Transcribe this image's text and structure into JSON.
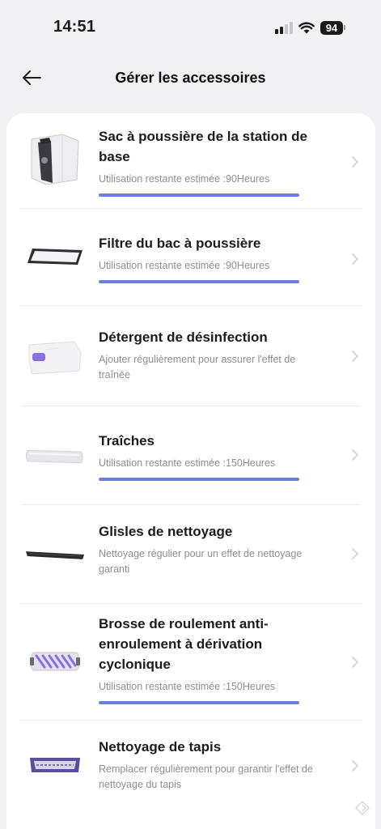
{
  "status_bar": {
    "time": "14:51",
    "battery": "94"
  },
  "header": {
    "title": "Gérer les accessoires"
  },
  "accessories": [
    {
      "title_lines": [
        "Sac à poussière de la station de",
        "base"
      ],
      "subtitle": "Utilisation restante estimée :90Heures",
      "progress": 1.0
    },
    {
      "title_lines": [
        "Filtre du bac à poussière"
      ],
      "subtitle": "Utilisation restante estimée :90Heures",
      "progress": 1.0
    },
    {
      "title_lines": [
        "Détergent de désinfection"
      ],
      "subtitle_lines": [
        "Ajouter régulièrement pour assurer l'effet de",
        "traînée"
      ]
    },
    {
      "title_lines": [
        "Traîches"
      ],
      "subtitle": "Utilisation restante estimée :150Heures",
      "progress": 1.0
    },
    {
      "title_lines": [
        "Glisles de nettoyage"
      ],
      "subtitle_lines": [
        "Nettoyage régulier pour un effet de nettoyage",
        "garanti"
      ]
    },
    {
      "title_lines": [
        "Brosse de roulement anti-",
        "enroulement à dérivation",
        "cyclonique"
      ],
      "subtitle": "Utilisation restante estimée :150Heures",
      "progress": 1.0
    },
    {
      "title_lines": [
        "Nettoyage de tapis"
      ],
      "subtitle_lines": [
        "Remplacer régulièrement pour garantir l'effet de",
        "nettoyage du tapis"
      ]
    }
  ],
  "colors": {
    "progress": "#6a7ed8",
    "accent_purple": "#8b6fe0"
  },
  "icons": [
    "back-arrow-icon",
    "chevron-right-icon",
    "signal-icon",
    "wifi-icon",
    "battery-icon"
  ]
}
